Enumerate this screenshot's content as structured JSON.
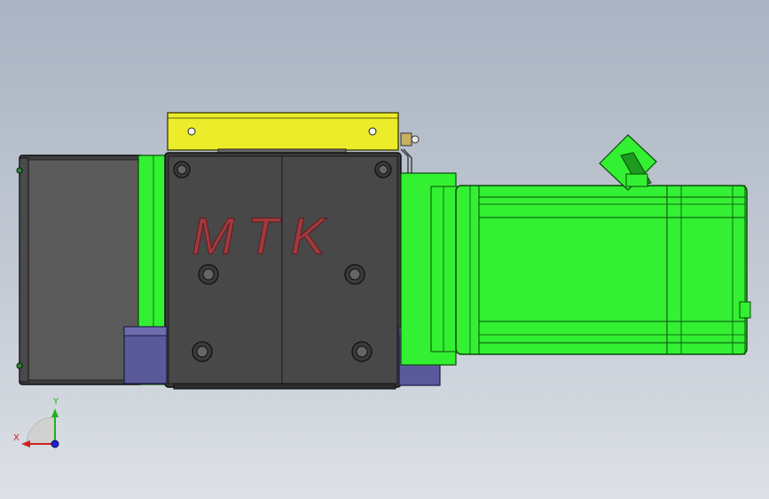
{
  "model": {
    "logo_text": "MTK",
    "colors": {
      "background_top": "#a9b3c2",
      "background_bottom": "#dde1e6",
      "gearbox_body": "#5a5a5a",
      "plate_body": "#484848",
      "motor_green": "#33f033",
      "mount_bracket": "#ecec2a",
      "foot_blue": "#5a5a9a",
      "logo_red": "#a03a3e"
    }
  },
  "triad": {
    "x_label": "X",
    "y_label": "Y",
    "x_color": "#d02020",
    "y_color": "#20b020",
    "z_color": "#2020d0"
  }
}
